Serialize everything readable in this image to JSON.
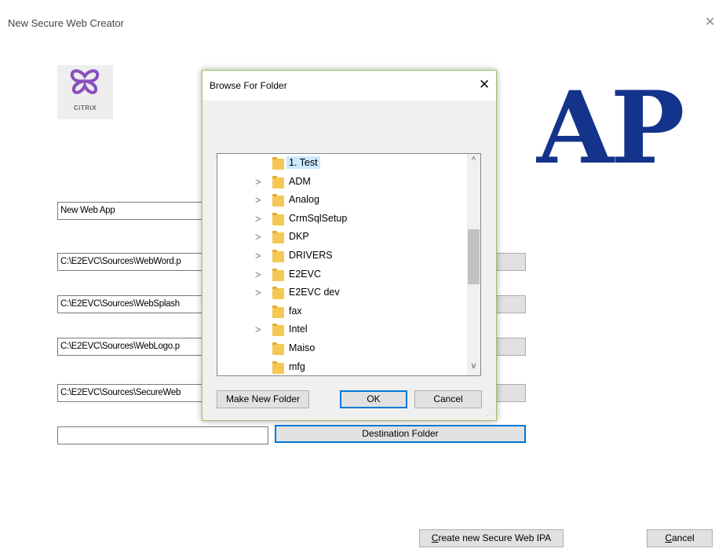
{
  "window": {
    "title": "New Secure Web Creator",
    "close_glyph": "✕"
  },
  "logos": {
    "citrix_text": "CiTRiX",
    "ap_text": "AP"
  },
  "form": {
    "app_name": "New Web App",
    "field_word": "C:\\E2EVC\\Sources\\WebWord.p",
    "field_splash": "C:\\E2EVC\\Sources\\WebSplash",
    "field_logo": "C:\\E2EVC\\Sources\\WebLogo.p",
    "field_secure": "C:\\E2EVC\\Sources\\SecureWeb",
    "destination_value": "",
    "destination_button": "Destination Folder",
    "create_button": "Create new Secure Web IPA",
    "cancel_button": "Cancel"
  },
  "dialog": {
    "title": "Browse For Folder",
    "close_glyph": "✕",
    "folders": [
      {
        "label": "1. Test",
        "expandable": false,
        "selected": true
      },
      {
        "label": "ADM",
        "expandable": true,
        "selected": false
      },
      {
        "label": "Analog",
        "expandable": true,
        "selected": false
      },
      {
        "label": "CrmSqlSetup",
        "expandable": true,
        "selected": false
      },
      {
        "label": "DKP",
        "expandable": true,
        "selected": false
      },
      {
        "label": "DRIVERS",
        "expandable": true,
        "selected": false
      },
      {
        "label": "E2EVC",
        "expandable": true,
        "selected": false
      },
      {
        "label": "E2EVC dev",
        "expandable": true,
        "selected": false
      },
      {
        "label": "fax",
        "expandable": false,
        "selected": false
      },
      {
        "label": "Intel",
        "expandable": true,
        "selected": false
      },
      {
        "label": "Maiso",
        "expandable": false,
        "selected": false
      },
      {
        "label": "mfg",
        "expandable": false,
        "selected": false
      }
    ],
    "make_new_folder": "Make New Folder",
    "ok": "OK",
    "cancel": "Cancel",
    "chevron_glyph": ">",
    "scroll_up_glyph": "^",
    "scroll_down_glyph": "v"
  },
  "colors": {
    "accent": "#0078d7",
    "ap_logo": "#14338a",
    "citrix_purple": "#8a4fbe",
    "dialog_border": "#9bc26a",
    "selection": "#cce8ff"
  }
}
